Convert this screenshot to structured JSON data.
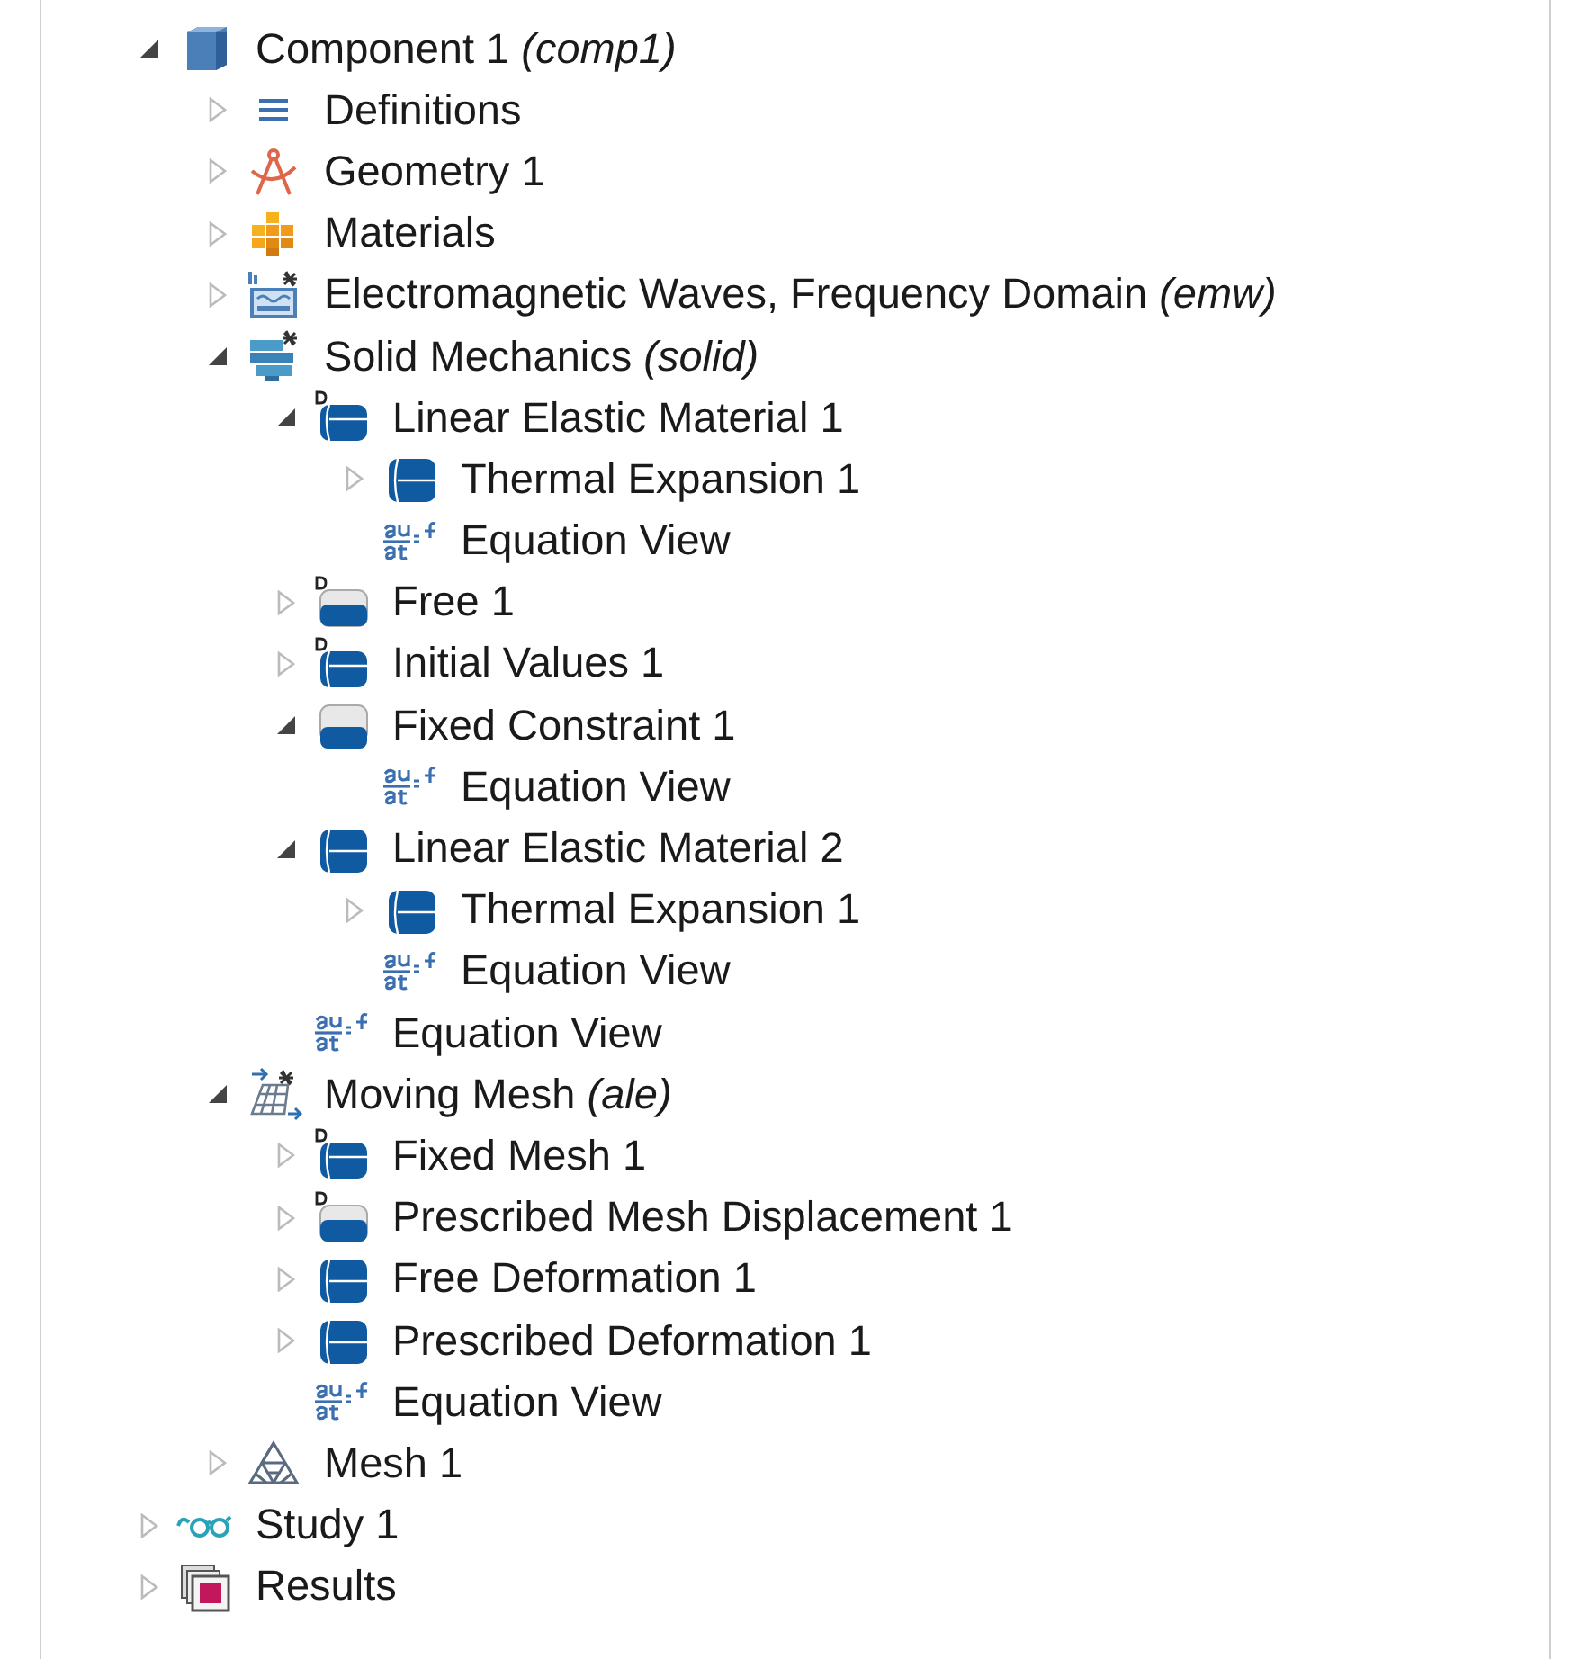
{
  "tree": [
    {
      "label": "Component 1 *(comp1)*",
      "kind": "component",
      "expanded": true,
      "children": [
        {
          "label": "Definitions",
          "kind": "definitions",
          "expanded": false
        },
        {
          "label": "Geometry 1",
          "kind": "geometry",
          "expanded": false
        },
        {
          "label": "Materials",
          "kind": "materials",
          "expanded": false
        },
        {
          "label": "Electromagnetic Waves, Frequency Domain *(emw)*",
          "kind": "waves",
          "expanded": false
        },
        {
          "label": "Solid Mechanics *(solid)*",
          "kind": "solid",
          "expanded": true,
          "children": [
            {
              "label": "Linear Elastic Material 1",
              "kind": "domain",
              "default": true,
              "expanded": true,
              "children": [
                {
                  "label": "Thermal Expansion 1",
                  "kind": "domain",
                  "default": false,
                  "expanded": false
                },
                {
                  "label": "Equation View",
                  "kind": "equation"
                }
              ]
            },
            {
              "label": "Free 1",
              "kind": "boundary",
              "default": true,
              "expanded": false
            },
            {
              "label": "Initial Values 1",
              "kind": "domain",
              "default": true,
              "expanded": false
            },
            {
              "label": "Fixed Constraint 1",
              "kind": "boundary",
              "default": false,
              "expanded": true,
              "children": [
                {
                  "label": "Equation View",
                  "kind": "equation"
                }
              ]
            },
            {
              "label": "Linear Elastic Material 2",
              "kind": "domain",
              "default": false,
              "expanded": true,
              "children": [
                {
                  "label": "Thermal Expansion 1",
                  "kind": "domain",
                  "default": false,
                  "expanded": false
                },
                {
                  "label": "Equation View",
                  "kind": "equation"
                }
              ]
            },
            {
              "label": "Equation View",
              "kind": "equation"
            }
          ]
        },
        {
          "label": "Moving Mesh *(ale)*",
          "kind": "moving-mesh",
          "expanded": true,
          "children": [
            {
              "label": "Fixed Mesh 1",
              "kind": "domain",
              "default": true,
              "expanded": false
            },
            {
              "label": "Prescribed Mesh Displacement 1",
              "kind": "boundary",
              "default": true,
              "expanded": false
            },
            {
              "label": "Free Deformation 1",
              "kind": "domain",
              "default": false,
              "expanded": false
            },
            {
              "label": "Prescribed Deformation 1",
              "kind": "domain",
              "default": false,
              "expanded": false
            },
            {
              "label": "Equation View",
              "kind": "equation"
            }
          ]
        },
        {
          "label": "Mesh 1",
          "kind": "mesh",
          "expanded": false
        }
      ]
    },
    {
      "label": "Study 1",
      "kind": "study",
      "expanded": false
    },
    {
      "label": "Results",
      "kind": "results",
      "expanded": false
    }
  ]
}
